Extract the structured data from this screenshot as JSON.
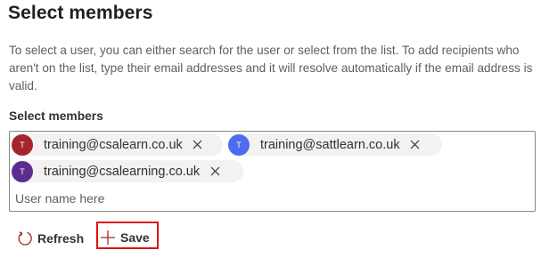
{
  "title": "Select members",
  "description": "To select a user, you can either search for the user or select from the list. To add recipients who aren't on the list, type their email addresses and it will resolve automatically if the email address is valid.",
  "picker": {
    "label": "Select members",
    "placeholder": "User name here",
    "value": "",
    "chips": [
      {
        "initial": "T",
        "email": "training@csalearn.co.uk",
        "color": "#a4262c"
      },
      {
        "initial": "T",
        "email": "training@sattlearn.co.uk",
        "color": "#4f6bed"
      },
      {
        "initial": "T",
        "email": "training@csalearning.co.uk",
        "color": "#5c2e91"
      }
    ],
    "remove_icon": "close-icon"
  },
  "toolbar": {
    "refresh_label": "Refresh",
    "refresh_icon": "refresh-icon",
    "save_label": "Save",
    "save_icon": "plus-icon",
    "highlight_color": "#e01010"
  }
}
